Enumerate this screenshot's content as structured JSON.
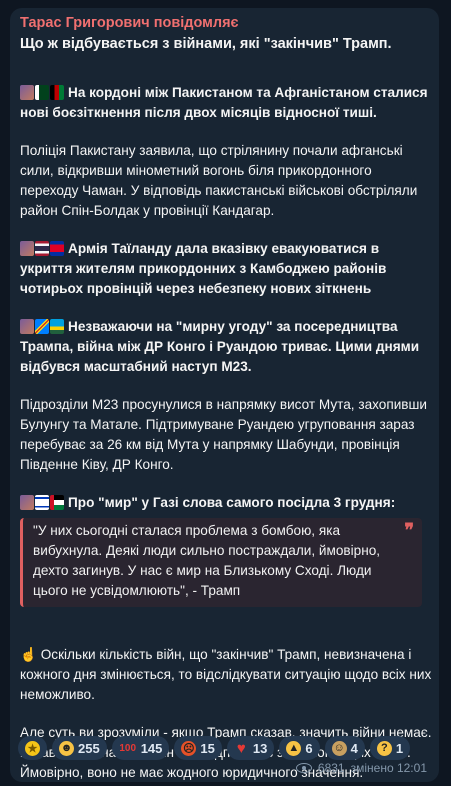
{
  "message": {
    "sender": "Тарас Григорович повідомляє",
    "title": "Що ж відбувається з війнами, які \"закінчив\" Трамп.",
    "sections": [
      {
        "headline": "На кордоні між Пакистаном та Афганістаном сталися нові боєзіткнення після двох місяців відносної тиші.",
        "icons": [
          "flag-collage-icon",
          "pakistan-flag-icon",
          "afghanistan-flag-icon"
        ]
      },
      {
        "body": "Поліція Пакистану заявила, що стрілянину почали афганські сили, відкривши мінометний вогонь біля прикордонного переходу Чаман. У відповідь пакистанські військові обстріляли район Спін-Болдак у провінції Кандагар."
      },
      {
        "headline": "Армія Таїланду дала вказівку евакуюватися в укриття жителям прикордонних з Камбоджею районів чотирьох провінцій через небезпеку нових зіткнень",
        "icons": [
          "flag-collage-icon",
          "thailand-flag-icon",
          "cambodia-flag-icon"
        ]
      },
      {
        "headline": "Незважаючи на \"мирну угоду\" за посередництва Трампа, війна між ДР Конго і Руандою триває. Цими днями відбувся масштабний наступ М23.",
        "icons": [
          "flag-collage-icon",
          "dr-congo-flag-icon",
          "rwanda-flag-icon"
        ]
      },
      {
        "body": "Підрозділи М23 просунулися в напрямку висот Мута, захопивши Булунгу та Матале. Підтримуване Руандею угруповання зараз перебуває за 26 км від Мута у напрямку Шабунди, провінція Південне Ківу, ДР Конго."
      },
      {
        "headline": "Про \"мир\" у Газі слова самого посідла 3 грудня:",
        "icons": [
          "flag-collage-icon",
          "israel-flag-icon",
          "palestine-flag-icon"
        ]
      }
    ],
    "quote": "\"У них сьогодні сталася проблема з бомбою, яка вибухнула. Деякі люди сильно постраждали, ймовірно, дехто загинув. У нас є мир на Близькому Сході. Люди цього не усвідомлюють\", - Трамп",
    "closing1": "Оскільки кількість війн, що \"закінчив\" Трамп, невизначена і кожного дня змінюється, то відслідкувати ситуацію щодо всіх них неможливо.",
    "closing2": "Але суть ви зрозуміли - якщо Трамп сказав, значить війни немає. Я навіть не знаю, що він там підписував з кожною з цих країн. Ймовірно, воно не має жодного юридичного значення.",
    "closing_icon": "pointing-finger-icon"
  },
  "reactions": [
    {
      "icon": "star-icon",
      "count": "",
      "color": "#f5c518"
    },
    {
      "icon": "rofl-icon",
      "count": "255",
      "color": "#f6c244"
    },
    {
      "icon": "hundred-icon",
      "count": "145",
      "color": "#e53935"
    },
    {
      "icon": "angry-face-icon",
      "count": "15",
      "color": "#e65128"
    },
    {
      "icon": "heart-icon",
      "count": "13",
      "color": "#e53935"
    },
    {
      "icon": "thumbs-up-icon",
      "count": "6",
      "color": "#f6c244"
    },
    {
      "icon": "cowboy-face-icon",
      "count": "4",
      "color": "#c8a060"
    },
    {
      "icon": "thinking-face-icon",
      "count": "1",
      "color": "#f6c244"
    }
  ],
  "meta": {
    "views": "6831",
    "edited": "змінено 12:01"
  }
}
